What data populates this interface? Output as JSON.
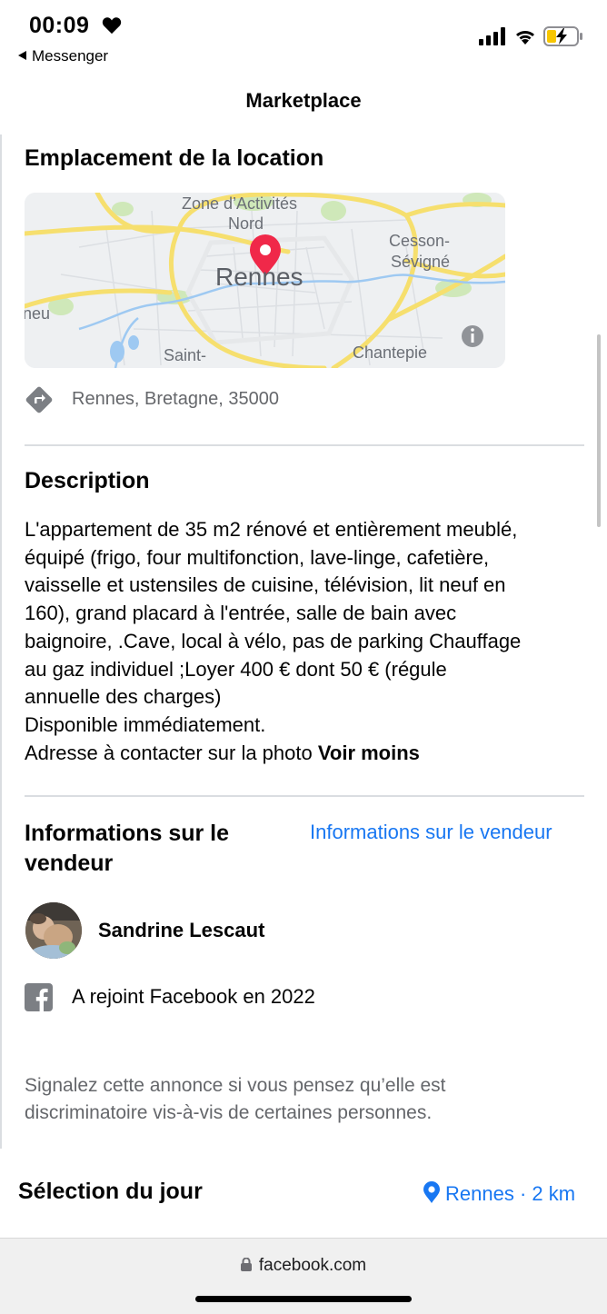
{
  "status_bar": {
    "time": "00:09",
    "back_app": "Messenger",
    "heart_icon": "heart-icon",
    "signal_icon": "cellular-signal-icon",
    "wifi_icon": "wifi-icon",
    "battery_icon": "battery-charging-icon"
  },
  "header": {
    "title": "Marketplace"
  },
  "location_section": {
    "title": "Emplacement de la location",
    "map_labels": {
      "zone": "Zone d’Activités",
      "nord": "Nord",
      "cesson": "Cesson-",
      "sevigne": "Sévigné",
      "city": "Rennes",
      "left": "neu",
      "saint": "Saint-",
      "chantepie": "Chantepie"
    },
    "address": "Rennes, Bretagne, 35000",
    "direction_icon": "directions-icon",
    "pin_icon": "map-pin-icon",
    "info_icon": "info-icon"
  },
  "description": {
    "title": "Description",
    "lines": [
      "L'appartement de 35 m2 rénové et entièrement meublé,",
      "équipé (frigo, four multifonction, lave-linge, cafetière,",
      "vaisselle et ustensiles de cuisine, télévision, lit neuf en",
      "160), grand placard à l'entrée, salle de bain avec",
      "baignoire, .Cave, local à vélo, pas de parking Chauffage",
      "au gaz individuel ;Loyer 400 € dont 50 € (régule",
      "annuelle des charges)",
      "Disponible immédiatement."
    ],
    "last_line": "Adresse à contacter sur la photo",
    "see_less": "Voir moins"
  },
  "seller": {
    "title": "Informations sur le vendeur",
    "link": "Informations sur le vendeur",
    "name": "Sandrine Lescaut",
    "joined": "A rejoint Facebook en 2022",
    "facebook_icon": "facebook-icon"
  },
  "report_text": "Signalez cette annonce si vous pensez qu’elle est discriminatoire vis-à-vis de certaines personnes.",
  "daily_selection": {
    "title": "Sélection du jour",
    "location": "Rennes · 2 km",
    "location_icon": "location-pin-icon"
  },
  "browser": {
    "url": "facebook.com",
    "lock_icon": "lock-icon"
  }
}
